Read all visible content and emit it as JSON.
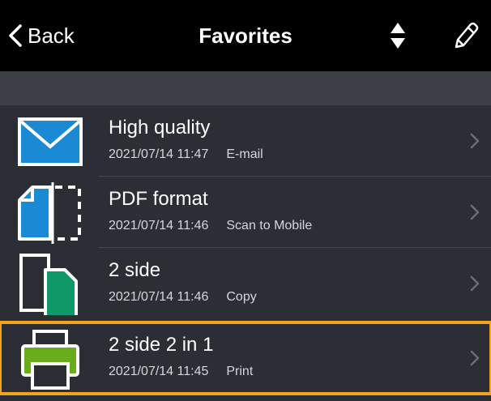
{
  "nav": {
    "back_label": "Back",
    "title": "Favorites"
  },
  "favorites": [
    {
      "name": "High quality",
      "timestamp": "2021/07/14 11:47",
      "type": "E-mail",
      "icon": "email-icon"
    },
    {
      "name": "PDF format",
      "timestamp": "2021/07/14 11:46",
      "type": "Scan to Mobile",
      "icon": "scan-to-mobile-icon"
    },
    {
      "name": "2 side",
      "timestamp": "2021/07/14 11:46",
      "type": "Copy",
      "icon": "copy-icon"
    },
    {
      "name": "2 side 2 in 1",
      "timestamp": "2021/07/14 11:45",
      "type": "Print",
      "icon": "printer-icon",
      "selected": true
    }
  ],
  "colors": {
    "background": "#2b2e35",
    "nav_bar": "#000000",
    "selection_outline": "#f5a31a",
    "email_blue": "#1a8ad4",
    "copy_green": "#0f9968",
    "print_green": "#6aad1b"
  }
}
